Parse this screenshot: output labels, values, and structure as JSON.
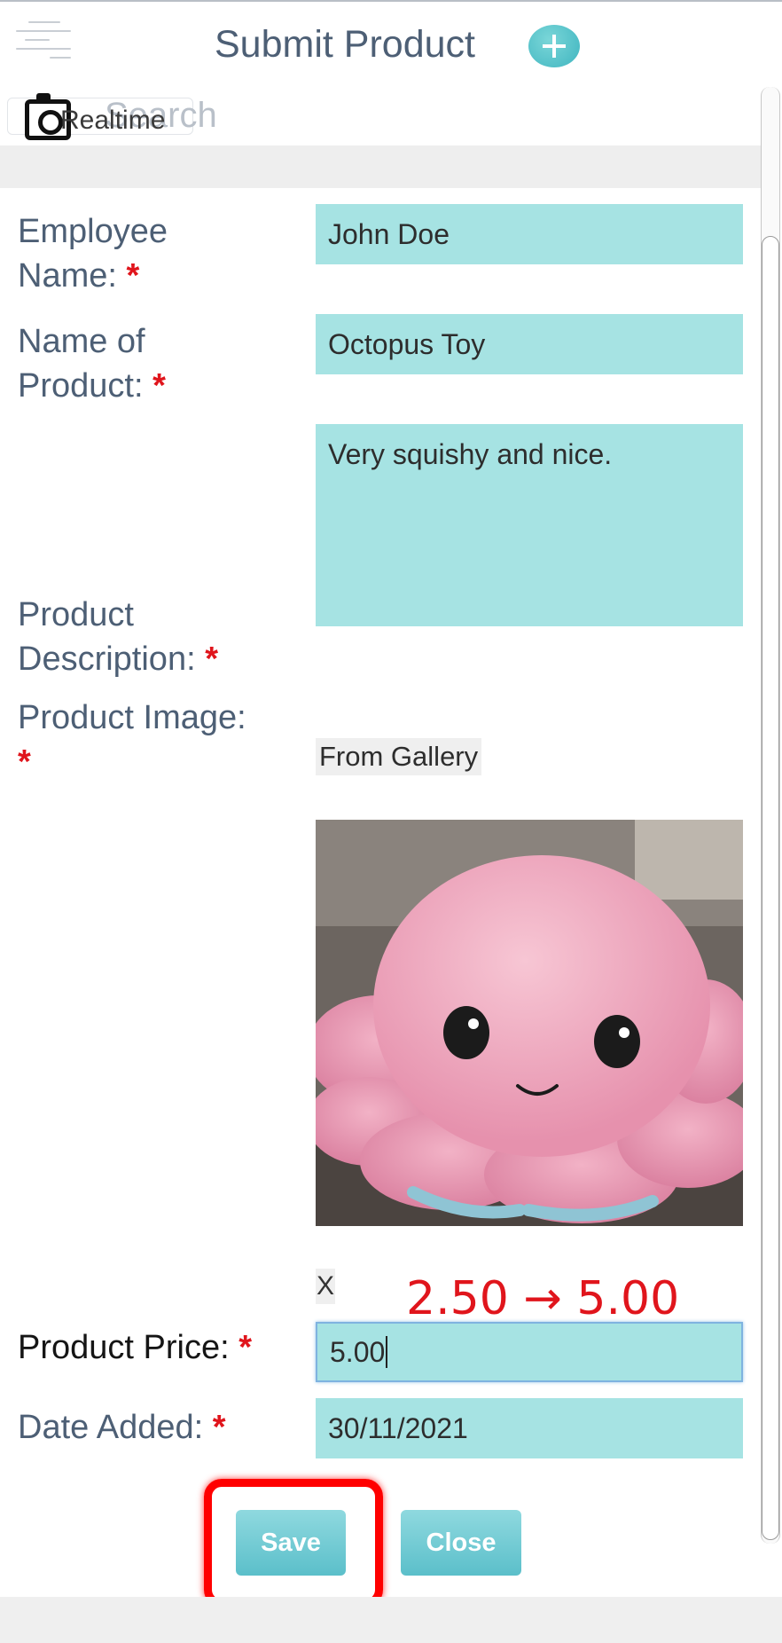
{
  "header": {
    "title": "Submit Product",
    "add_icon": "plus-circle-icon",
    "menu_icon": "menu-lines-icon"
  },
  "search": {
    "placeholder": "Search",
    "realtime_label": "Realtime",
    "camera_icon": "camera-icon"
  },
  "form": {
    "employee_name": {
      "label_line1": "Employee",
      "label_line2": "Name:",
      "required": "*",
      "value": "John Doe"
    },
    "product_name": {
      "label_line1": "Name of",
      "label_line2": "Product:",
      "required": "*",
      "value": "Octopus Toy"
    },
    "product_description": {
      "label_line1": "Product",
      "label_line2": "Description:",
      "required": "*",
      "value": "Very squishy and nice."
    },
    "product_image": {
      "label": "Product Image:",
      "required": "*",
      "gallery_button": "From Gallery",
      "remove_button": "X"
    },
    "product_price": {
      "label": "Product Price:",
      "required": "*",
      "value": "5.00"
    },
    "date_added": {
      "label": "Date Added:",
      "required": "*",
      "value": "30/11/2021"
    }
  },
  "annotation": {
    "text": "2.50 → 5.00"
  },
  "buttons": {
    "save": "Save",
    "close": "Close"
  },
  "colors": {
    "field_bg": "#a6e3e3",
    "label_text": "#4d5f75",
    "required": "#e0151c",
    "button_bg": "#5bbfca",
    "highlight": "#ff0000"
  }
}
